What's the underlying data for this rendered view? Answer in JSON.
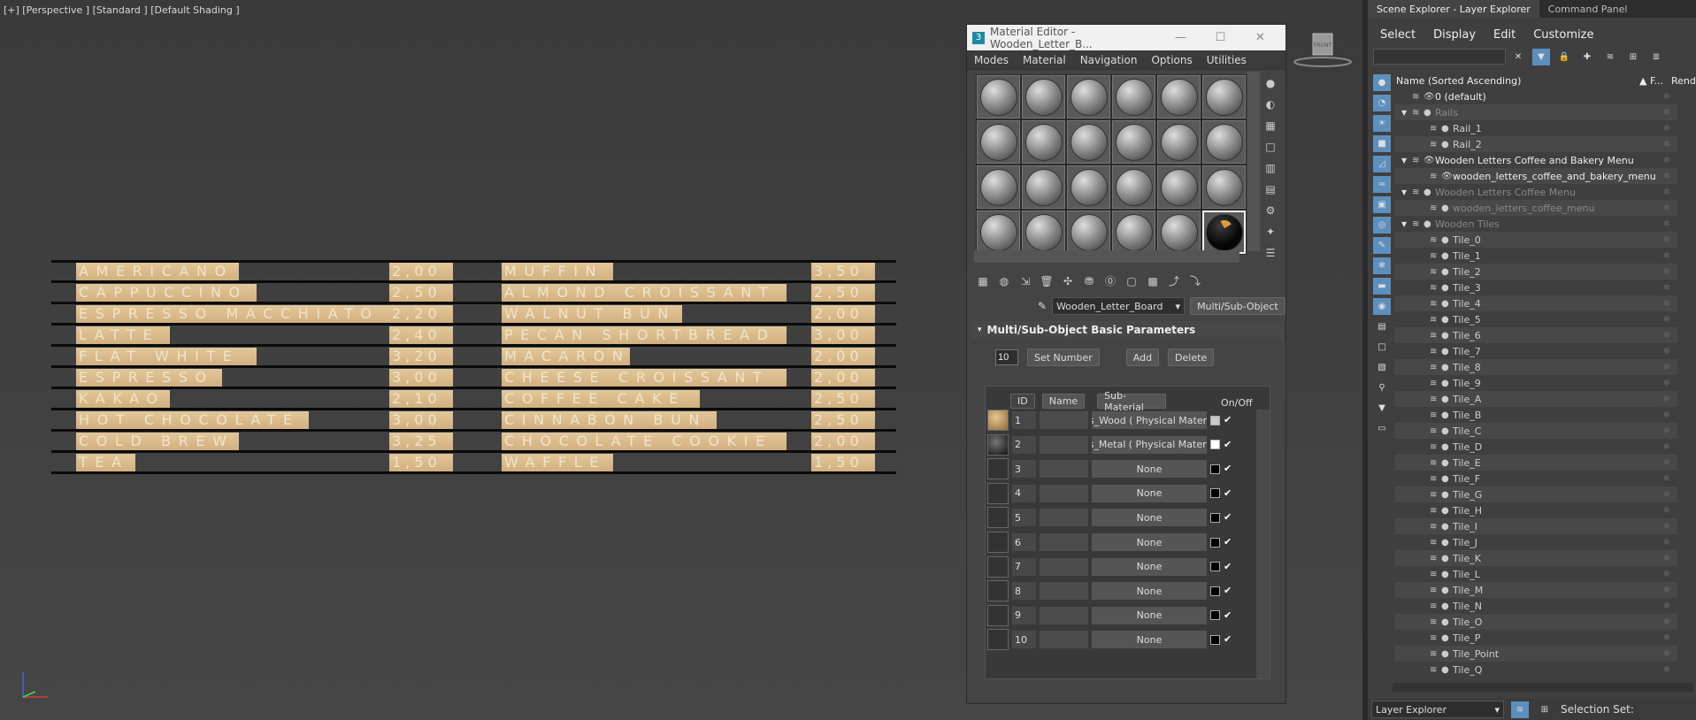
{
  "viewport": {
    "label": "[+] [Perspective ] [Standard ] [Default Shading ]"
  },
  "menu_board": {
    "rows": [
      {
        "item1": "AMERICANO",
        "price1": "2,00",
        "item2": "MUFFIN",
        "price2": "3,50"
      },
      {
        "item1": "CAPPUCCINO",
        "price1": "2,50",
        "item2": "ALMOND CROISSANT",
        "price2": "2,50"
      },
      {
        "item1": "ESPRESSO MACCHIATO",
        "price1": "2,20",
        "item2": "WALNUT BUN",
        "price2": "2,00"
      },
      {
        "item1": "LATTE",
        "price1": "2,40",
        "item2": "PECAN SHORTBREAD",
        "price2": "3,00"
      },
      {
        "item1": "FLAT WHITE",
        "price1": "3,20",
        "item2": "MACARON",
        "price2": "2,00"
      },
      {
        "item1": "ESPRESSO",
        "price1": "3,00",
        "item2": "CHEESE CROISSANT",
        "price2": "2,00"
      },
      {
        "item1": "KAKAO",
        "price1": "2,10",
        "item2": "COFFEE CAKE",
        "price2": "2,50"
      },
      {
        "item1": "HOT CHOCOLATE",
        "price1": "3,00",
        "item2": "CINNABON BUN",
        "price2": "2,50"
      },
      {
        "item1": "COLD BREW",
        "price1": "3,25",
        "item2": "CHOCOLATE COOKIE",
        "price2": "2,00"
      },
      {
        "item1": "TEA",
        "price1": "1,50",
        "item2": "WAFFLE",
        "price2": "1,50"
      }
    ]
  },
  "viewcube": {
    "label": "FRONT"
  },
  "material_editor": {
    "title": "Material Editor - Wooden_Letter_B...",
    "window_buttons": {
      "minimize": "—",
      "maximize": "☐",
      "close": "✕"
    },
    "menu": [
      "Modes",
      "Material",
      "Navigation",
      "Options",
      "Utilities"
    ],
    "material_name": "Wooden_Letter_Board",
    "material_type": "Multi/Sub-Object",
    "rollout_title": "Multi/Sub-Object Basic Parameters",
    "set_number_value": "10",
    "set_number_label": "Set Number",
    "add_label": "Add",
    "delete_label": "Delete",
    "columns": {
      "id": "ID",
      "name": "Name",
      "sub_material": "Sub-Material",
      "on_off": "On/Off"
    },
    "rows": [
      {
        "id": "1",
        "sub": "es_Wood  ( Physical Materia",
        "swatch": "#c8c8c8",
        "thumb": "wood"
      },
      {
        "id": "2",
        "sub": "ils_Metal  ( Physical Materia",
        "swatch": "#ffffff",
        "thumb": "metal"
      },
      {
        "id": "3",
        "sub": "None",
        "swatch": "#000000",
        "thumb": ""
      },
      {
        "id": "4",
        "sub": "None",
        "swatch": "#000000",
        "thumb": ""
      },
      {
        "id": "5",
        "sub": "None",
        "swatch": "#000000",
        "thumb": ""
      },
      {
        "id": "6",
        "sub": "None",
        "swatch": "#000000",
        "thumb": ""
      },
      {
        "id": "7",
        "sub": "None",
        "swatch": "#000000",
        "thumb": ""
      },
      {
        "id": "8",
        "sub": "None",
        "swatch": "#000000",
        "thumb": ""
      },
      {
        "id": "9",
        "sub": "None",
        "swatch": "#000000",
        "thumb": ""
      },
      {
        "id": "10",
        "sub": "None",
        "swatch": "#000000",
        "thumb": ""
      }
    ],
    "check_glyph": "✔"
  },
  "scene_explorer": {
    "tabs": [
      "Scene Explorer - Layer Explorer",
      "Command Panel"
    ],
    "menu": [
      "Select",
      "Display",
      "Edit",
      "Customize"
    ],
    "col_name": "Name (Sorted Ascending)",
    "col_f": "▲ F...",
    "col_r": "Rende",
    "items": [
      {
        "label": "0 (default)",
        "depth": 0,
        "exp": "",
        "kind": "top"
      },
      {
        "label": "Rails",
        "depth": 0,
        "exp": "▼",
        "kind": "dim"
      },
      {
        "label": "Rail_1",
        "depth": 1,
        "exp": "",
        "kind": "obj"
      },
      {
        "label": "Rail_2",
        "depth": 1,
        "exp": "",
        "kind": "obj"
      },
      {
        "label": "Wooden Letters Coffee and Bakery Menu",
        "depth": 0,
        "exp": "▼",
        "kind": "top"
      },
      {
        "label": "wooden_letters_coffee_and_bakery_menu",
        "depth": 1,
        "exp": "",
        "kind": "top"
      },
      {
        "label": "Wooden Letters Coffee Menu",
        "depth": 0,
        "exp": "▼",
        "kind": "dim"
      },
      {
        "label": "wooden_letters_coffee_menu",
        "depth": 1,
        "exp": "",
        "kind": "dim"
      },
      {
        "label": "Wooden Tiles",
        "depth": 0,
        "exp": "▼",
        "kind": "dim"
      },
      {
        "label": "Tile_0",
        "depth": 1,
        "exp": "",
        "kind": "obj"
      },
      {
        "label": "Tile_1",
        "depth": 1,
        "exp": "",
        "kind": "obj"
      },
      {
        "label": "Tile_2",
        "depth": 1,
        "exp": "",
        "kind": "obj"
      },
      {
        "label": "Tile_3",
        "depth": 1,
        "exp": "",
        "kind": "obj"
      },
      {
        "label": "Tile_4",
        "depth": 1,
        "exp": "",
        "kind": "obj"
      },
      {
        "label": "Tile_5",
        "depth": 1,
        "exp": "",
        "kind": "obj"
      },
      {
        "label": "Tile_6",
        "depth": 1,
        "exp": "",
        "kind": "obj"
      },
      {
        "label": "Tile_7",
        "depth": 1,
        "exp": "",
        "kind": "obj"
      },
      {
        "label": "Tile_8",
        "depth": 1,
        "exp": "",
        "kind": "obj"
      },
      {
        "label": "Tile_9",
        "depth": 1,
        "exp": "",
        "kind": "obj"
      },
      {
        "label": "Tile_A",
        "depth": 1,
        "exp": "",
        "kind": "obj"
      },
      {
        "label": "Tile_B",
        "depth": 1,
        "exp": "",
        "kind": "obj"
      },
      {
        "label": "Tile_C",
        "depth": 1,
        "exp": "",
        "kind": "obj"
      },
      {
        "label": "Tile_D",
        "depth": 1,
        "exp": "",
        "kind": "obj"
      },
      {
        "label": "Tile_E",
        "depth": 1,
        "exp": "",
        "kind": "obj"
      },
      {
        "label": "Tile_F",
        "depth": 1,
        "exp": "",
        "kind": "obj"
      },
      {
        "label": "Tile_G",
        "depth": 1,
        "exp": "",
        "kind": "obj"
      },
      {
        "label": "Tile_H",
        "depth": 1,
        "exp": "",
        "kind": "obj"
      },
      {
        "label": "Tile_I",
        "depth": 1,
        "exp": "",
        "kind": "obj"
      },
      {
        "label": "Tile_J",
        "depth": 1,
        "exp": "",
        "kind": "obj"
      },
      {
        "label": "Tile_K",
        "depth": 1,
        "exp": "",
        "kind": "obj"
      },
      {
        "label": "Tile_L",
        "depth": 1,
        "exp": "",
        "kind": "obj"
      },
      {
        "label": "Tile_M",
        "depth": 1,
        "exp": "",
        "kind": "obj"
      },
      {
        "label": "Tile_N",
        "depth": 1,
        "exp": "",
        "kind": "obj"
      },
      {
        "label": "Tile_O",
        "depth": 1,
        "exp": "",
        "kind": "obj"
      },
      {
        "label": "Tile_P",
        "depth": 1,
        "exp": "",
        "kind": "obj"
      },
      {
        "label": "Tile_Point",
        "depth": 1,
        "exp": "",
        "kind": "obj"
      },
      {
        "label": "Tile_Q",
        "depth": 1,
        "exp": "",
        "kind": "obj"
      }
    ],
    "footer_dropdown": "Layer Explorer",
    "selection_set_label": "Selection Set:"
  }
}
